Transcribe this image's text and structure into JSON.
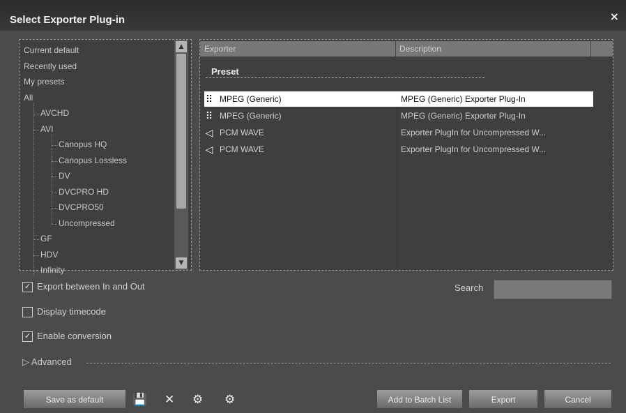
{
  "window": {
    "title": "Select Exporter Plug-in",
    "close_glyph": "×"
  },
  "tree": {
    "items": [
      {
        "label": "Current default",
        "level": 0
      },
      {
        "label": "Recently used",
        "level": 0
      },
      {
        "label": "My presets",
        "level": 0
      },
      {
        "label": "All",
        "level": 0
      },
      {
        "label": "AVCHD",
        "level": 1
      },
      {
        "label": "AVI",
        "level": 1
      },
      {
        "label": "Canopus HQ",
        "level": 2
      },
      {
        "label": "Canopus Lossless",
        "level": 2
      },
      {
        "label": "DV",
        "level": 2
      },
      {
        "label": "DVCPRO HD",
        "level": 2
      },
      {
        "label": "DVCPRO50",
        "level": 2
      },
      {
        "label": "Uncompressed",
        "level": 2
      },
      {
        "label": "GF",
        "level": 1
      },
      {
        "label": "HDV",
        "level": 1
      },
      {
        "label": "Infinity",
        "level": 1
      }
    ]
  },
  "list": {
    "columns": [
      "Exporter",
      "Description"
    ],
    "group_label": "Preset",
    "rows": [
      {
        "icon": "mpeg-icon",
        "glyph": "⠿",
        "exporter": "MPEG (Generic)",
        "description": "MPEG (Generic) Exporter Plug-In",
        "selected": true
      },
      {
        "icon": "mpeg-icon",
        "glyph": "⠿",
        "exporter": "MPEG (Generic)",
        "description": "MPEG (Generic) Exporter Plug-In",
        "selected": false
      },
      {
        "icon": "audio-wave-icon",
        "glyph": "◁",
        "exporter": "PCM WAVE",
        "description": "Exporter PlugIn for Uncompressed W...",
        "selected": false
      },
      {
        "icon": "audio-wave-icon",
        "glyph": "◁",
        "exporter": "PCM WAVE",
        "description": "Exporter PlugIn for Uncompressed W...",
        "selected": false
      }
    ]
  },
  "options": {
    "export_between": {
      "label": "Export between In and Out",
      "checked": true
    },
    "display_timecode": {
      "label": "Display timecode",
      "checked": false
    },
    "enable_conversion": {
      "label": "Enable conversion",
      "checked": true
    }
  },
  "search": {
    "label": "Search",
    "value": ""
  },
  "advanced": {
    "label": "Advanced"
  },
  "footer": {
    "save_default": "Save as default",
    "save_icon": "💾",
    "delete_icon": "✕",
    "icon3": "⚙",
    "icon4": "⚙",
    "add_batch": "Add to Batch List",
    "export": "Export",
    "cancel": "Cancel"
  },
  "colors": {
    "selected_row_bg": "#ffffff",
    "panel_bg": "#3f3f3f",
    "window_bg": "#4b4b4b"
  }
}
